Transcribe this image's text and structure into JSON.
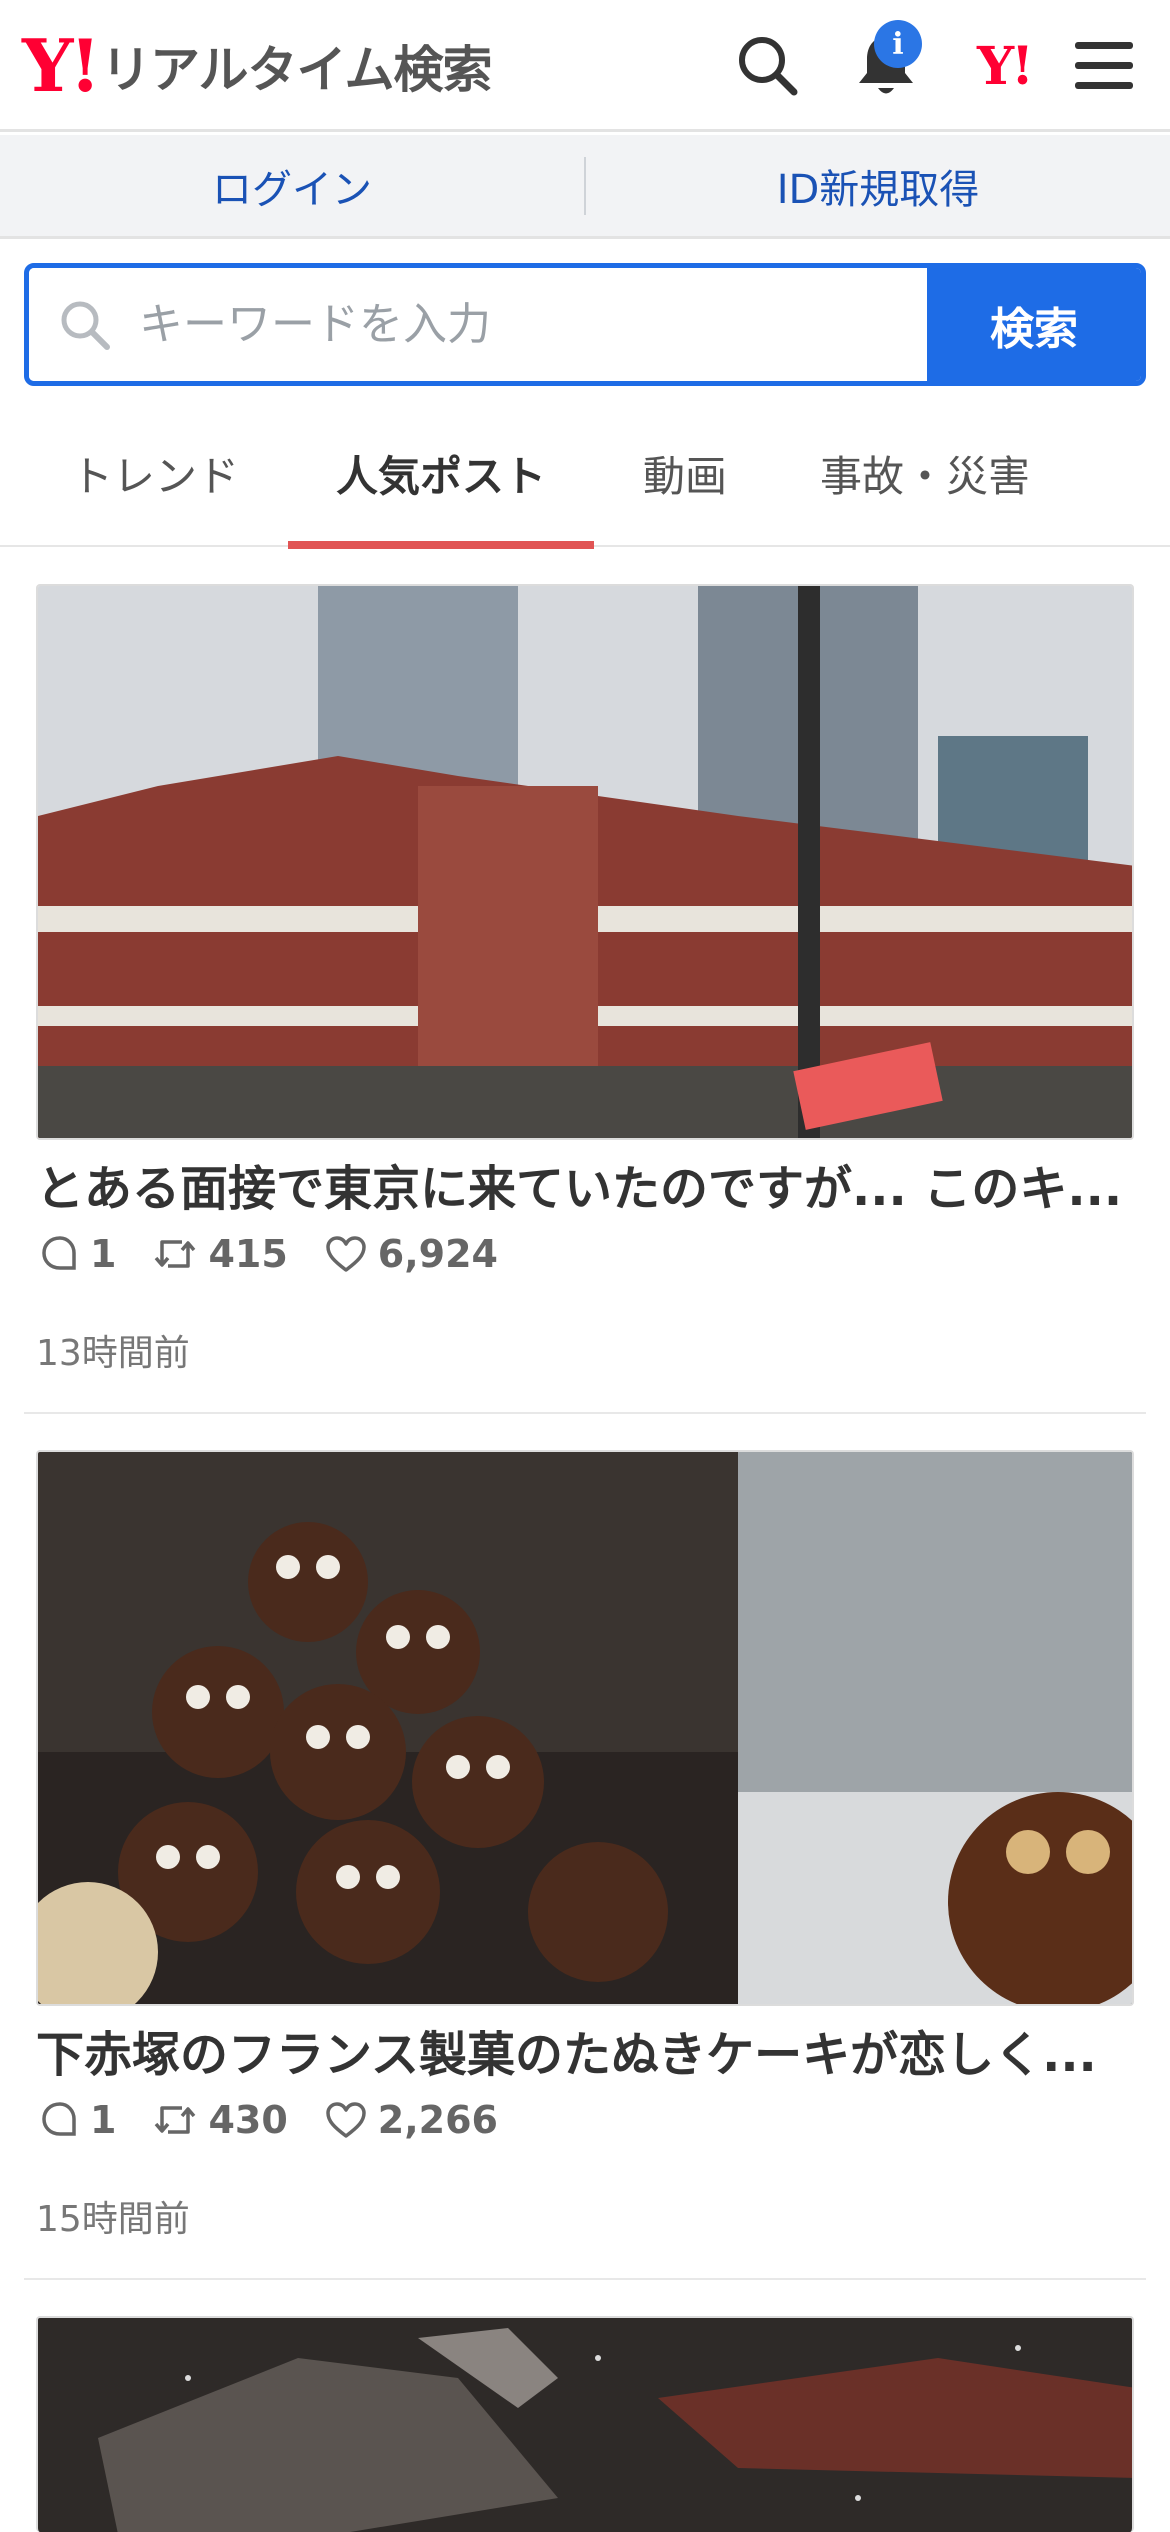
{
  "header": {
    "logo_mark": "Y!",
    "logo_text": "リアルタイム検索",
    "notification_badge": "i",
    "yj_mark": "Y!"
  },
  "account": {
    "login_label": "ログイン",
    "register_label": "ID新規取得"
  },
  "search": {
    "placeholder": "キーワードを入力",
    "button_label": "検索"
  },
  "tabs": [
    {
      "label": "トレンド",
      "active": false
    },
    {
      "label": "人気ポスト",
      "active": true
    },
    {
      "label": "動画",
      "active": false
    },
    {
      "label": "事故・災害",
      "active": false
    }
  ],
  "posts": [
    {
      "title": "とある面接で東京に来ていたのですが... このキ...",
      "replies": "1",
      "reposts": "415",
      "likes": "6,924",
      "time": "13時間前",
      "image_icon": "photo-tokyo-station"
    },
    {
      "title": "下赤塚のフランス製菓のたぬきケーキが恋しく...",
      "replies": "1",
      "reposts": "430",
      "likes": "2,266",
      "time": "15時間前",
      "image_icon": "photo-tanuki-cakes"
    },
    {
      "image_icon": "photo-dark-scene"
    }
  ],
  "colors": {
    "brand_red": "#ff0033",
    "accent_blue": "#1e6ce6",
    "tab_underline": "#e15454"
  }
}
